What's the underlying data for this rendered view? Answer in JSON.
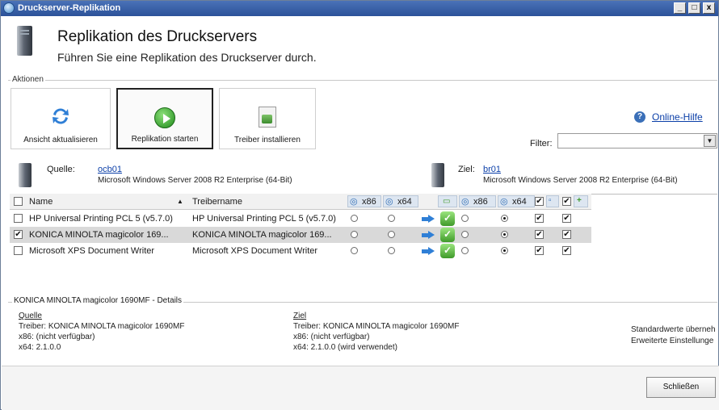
{
  "window": {
    "title": "Druckserver-Replikation",
    "controls": [
      "_",
      "□",
      "x"
    ]
  },
  "header": {
    "title": "Replikation des Druckservers",
    "subtitle": "Führen Sie eine Replikation des Druckserver durch."
  },
  "actions": {
    "legend": "Aktionen",
    "refresh_label": "Ansicht aktualisieren",
    "start_label": "Replikation starten",
    "install_label": "Treiber installieren",
    "help_link": "Online-Hilfe",
    "filter_label": "Filter:",
    "filter_value": ""
  },
  "source": {
    "label": "Quelle:",
    "name": "ocb01",
    "os": "Microsoft Windows Server 2008 R2 Enterprise  (64-Bit)"
  },
  "target": {
    "label": "Ziel:",
    "name": "br01",
    "os": "Microsoft Windows Server 2008 R2 Enterprise  (64-Bit)"
  },
  "grid": {
    "columns": {
      "name": "Name",
      "driver": "Treibername",
      "x86": "x86",
      "x64": "x64",
      "x86b": "x86",
      "x64b": "x64"
    },
    "rows": [
      {
        "checked": false,
        "name": "HP Universal Printing PCL 5 (v5.7.0)",
        "driver": "HP Universal Printing PCL 5 (v5.7.0)",
        "selected": false
      },
      {
        "checked": true,
        "name": "KONICA MINOLTA magicolor 169...",
        "driver": "KONICA MINOLTA magicolor 169...",
        "selected": true
      },
      {
        "checked": false,
        "name": "Microsoft XPS Document Writer",
        "driver": "Microsoft XPS Document Writer",
        "selected": false
      }
    ]
  },
  "details": {
    "legend": "KONICA MINOLTA magicolor 1690MF - Details",
    "source_heading": "Quelle",
    "source_driver": "Treiber: KONICA MINOLTA magicolor 1690MF",
    "source_x86": "x86: (nicht verfügbar)",
    "source_x64": "x64: 2.1.0.0",
    "target_heading": "Ziel",
    "target_driver": "Treiber: KONICA MINOLTA magicolor 1690MF",
    "target_x86": "x86: (nicht verfügbar)",
    "target_x64": "x64: 2.1.0.0 (wird verwendet)",
    "option1": "Standardwerte überneh",
    "option2": "Erweiterte Einstellunge"
  },
  "footer": {
    "close_label": "Schließen"
  }
}
